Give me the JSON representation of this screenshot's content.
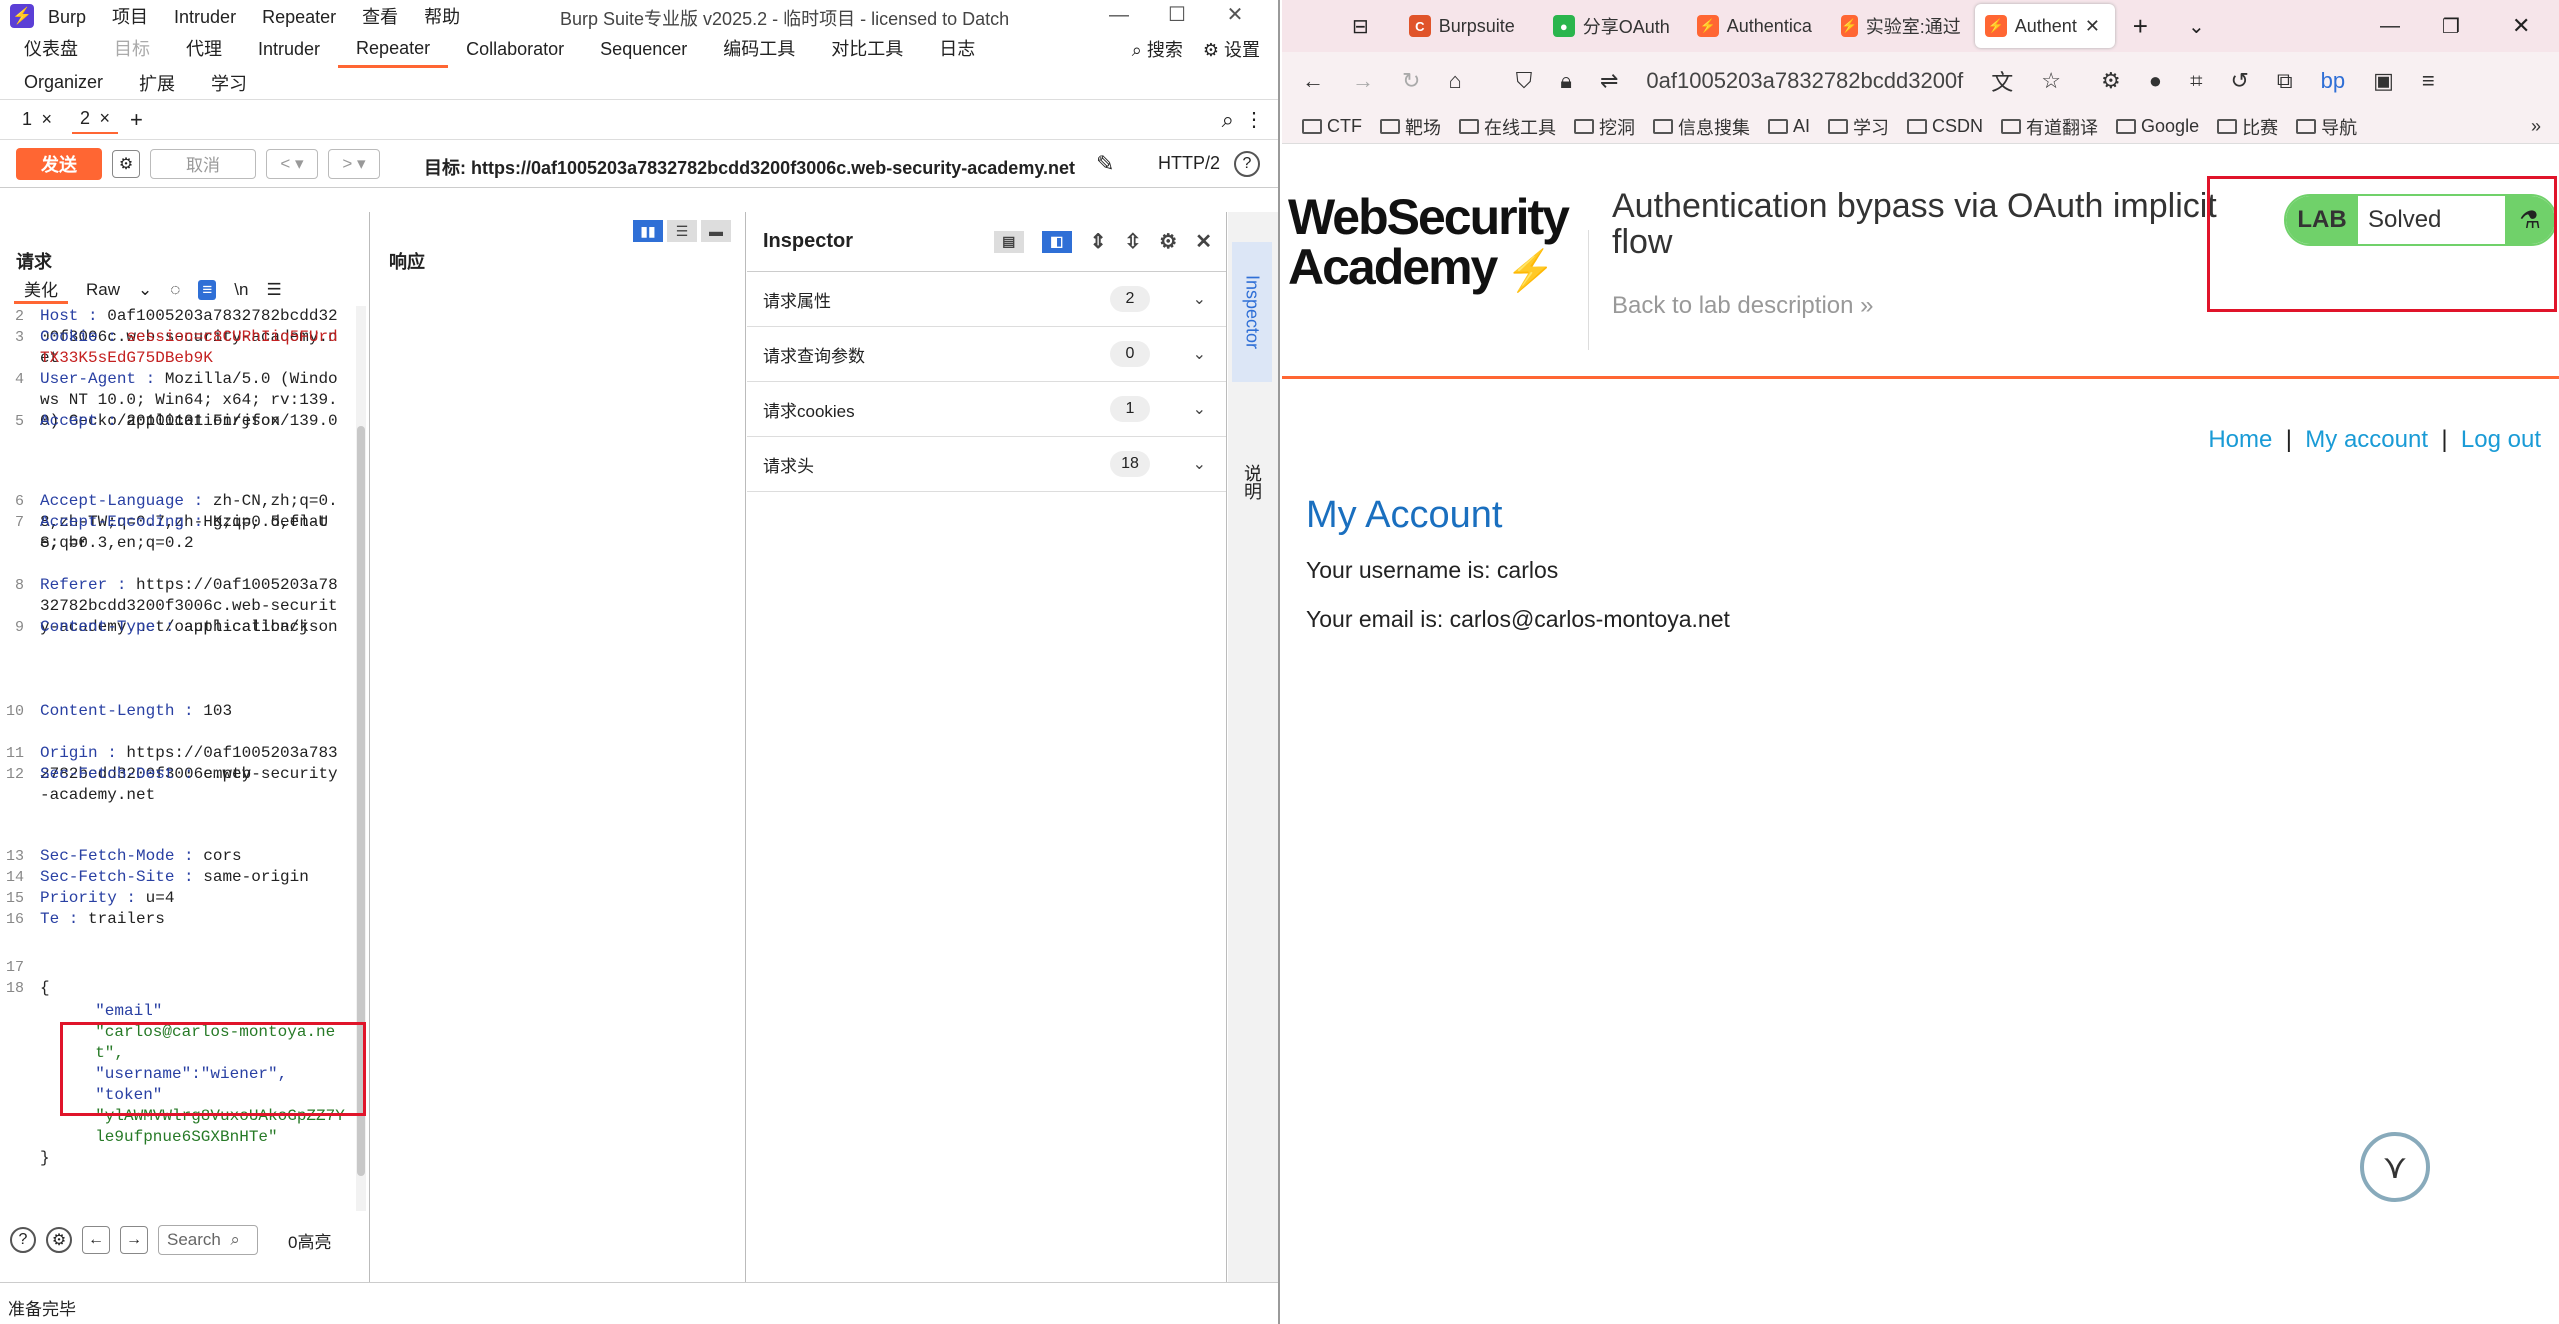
{
  "burp": {
    "menu": [
      "Burp",
      "项目",
      "Intruder",
      "Repeater",
      "查看",
      "帮助"
    ],
    "window_title": "Burp Suite专业版  v2025.2 - 临时项目 - licensed to Datch",
    "tabs_row1": [
      "仪表盘",
      "目标",
      "代理",
      "Intruder",
      "Repeater",
      "Collaborator",
      "Sequencer",
      "编码工具",
      "对比工具",
      "日志"
    ],
    "search": "搜索",
    "settings": "设置",
    "tabs_row2": [
      "Organizer",
      "扩展",
      "学习"
    ],
    "repeater_tabs": [
      "1",
      "2"
    ],
    "send": "发送",
    "cancel": "取消",
    "target": "目标: https://0af1005203a7832782bcdd3200f3006c.web-security-academy.net",
    "http": "HTTP/2",
    "request_title": "请求",
    "tab_pretty": "美化",
    "tab_raw": "Raw",
    "tab_newline": "\\n",
    "response_title": "响应",
    "request_lines": [
      {
        "n": "2",
        "k": "Host",
        "v": "0af1005203a7832782bcdd3200f3006c.web-security-academy.net"
      },
      {
        "n": "3",
        "k": "Cookie",
        "v": "session=c8CURhIiq5FUrdTX33K5sEdG75DBeb9K"
      },
      {
        "n": "4",
        "k": "User-Agent",
        "v": "Mozilla/5.0 (Windows NT 10.0; Win64; x64; rv:139.0) Gecko/20100101 Firefox/139.0"
      },
      {
        "n": "5",
        "k": "Accept",
        "v": "application/json"
      },
      {
        "n": "6",
        "k": "Accept-Language",
        "v": "zh-CN,zh;q=0.8,zh-TW;q=0.7,zh-HK;q=0.5,en-US;q=0.3,en;q=0.2"
      },
      {
        "n": "7",
        "k": "Accept-Encoding",
        "v": "gzip, deflate, br"
      },
      {
        "n": "8",
        "k": "Referer",
        "v": "https://0af1005203a7832782bcdd3200f3006c.web-security-academy.net/oauth-callback"
      },
      {
        "n": "9",
        "k": "Content-Type",
        "v": "application/json"
      },
      {
        "n": "10",
        "k": "Content-Length",
        "v": "103"
      },
      {
        "n": "11",
        "k": "Origin",
        "v": "https://0af1005203a7832782bcdd3200f3006c.web-security-academy.net"
      },
      {
        "n": "12",
        "k": "Sec-Fetch-Dest",
        "v": "empty"
      },
      {
        "n": "13",
        "k": "Sec-Fetch-Mode",
        "v": "cors"
      },
      {
        "n": "14",
        "k": "Sec-Fetch-Site",
        "v": "same-origin"
      },
      {
        "n": "15",
        "k": "Priority",
        "v": "u=4"
      },
      {
        "n": "16",
        "k": "Te",
        "v": "trailers"
      }
    ],
    "body": {
      "open": "{",
      "email_key": "\"email\"",
      "email_val": "\"carlos@carlos-montoya.net\",",
      "username": "\"username\":\"wiener\",",
      "token_key": "\"token\"",
      "token_val": "\"ylAWMVWlrg8VuxoUAkoGpZZ7Yle9ufpnue6SGXBnHTe\"",
      "close": "}",
      "n17": "17",
      "n18": "18"
    },
    "search_placeholder": "Search",
    "highlight": "0高亮",
    "inspector": {
      "title": "Inspector",
      "rows": [
        {
          "label": "请求属性",
          "count": "2"
        },
        {
          "label": "请求查询参数",
          "count": "0"
        },
        {
          "label": "请求cookies",
          "count": "1"
        },
        {
          "label": "请求头",
          "count": "18"
        }
      ]
    },
    "side_tabs": [
      "Inspector",
      "说明"
    ],
    "status": "准备完毕"
  },
  "firefox": {
    "tabs": [
      "Burpsuite",
      "分享OAuth",
      "Authentica",
      "实验室:通过",
      "Authent"
    ],
    "url": "0af1005203a7832782bcdd3200f",
    "bookmarks": [
      "CTF",
      "靶场",
      "在线工具",
      "挖洞",
      "信息搜集",
      "AI",
      "学习",
      "CSDN",
      "有道翻译",
      "Google",
      "比赛",
      "导航"
    ],
    "logo_line1": "WebSecurity",
    "logo_line2": "Academy",
    "lab_title": "Authentication bypass via OAuth implicit flow",
    "back_link": "Back to lab description",
    "lab_label": "LAB",
    "lab_status": "Solved",
    "nav": {
      "home": "Home",
      "account": "My account",
      "logout": "Log out",
      "sep": "|"
    },
    "heading": "My Account",
    "username_line": "Your username is: carlos",
    "email_line": "Your email is: carlos@carlos-montoya.net"
  },
  "colors": {
    "burp_accent": "#ff6633",
    "lab_green": "#70d16a",
    "link_blue": "#1a9bd6",
    "highlight_red": "#e0142a"
  }
}
